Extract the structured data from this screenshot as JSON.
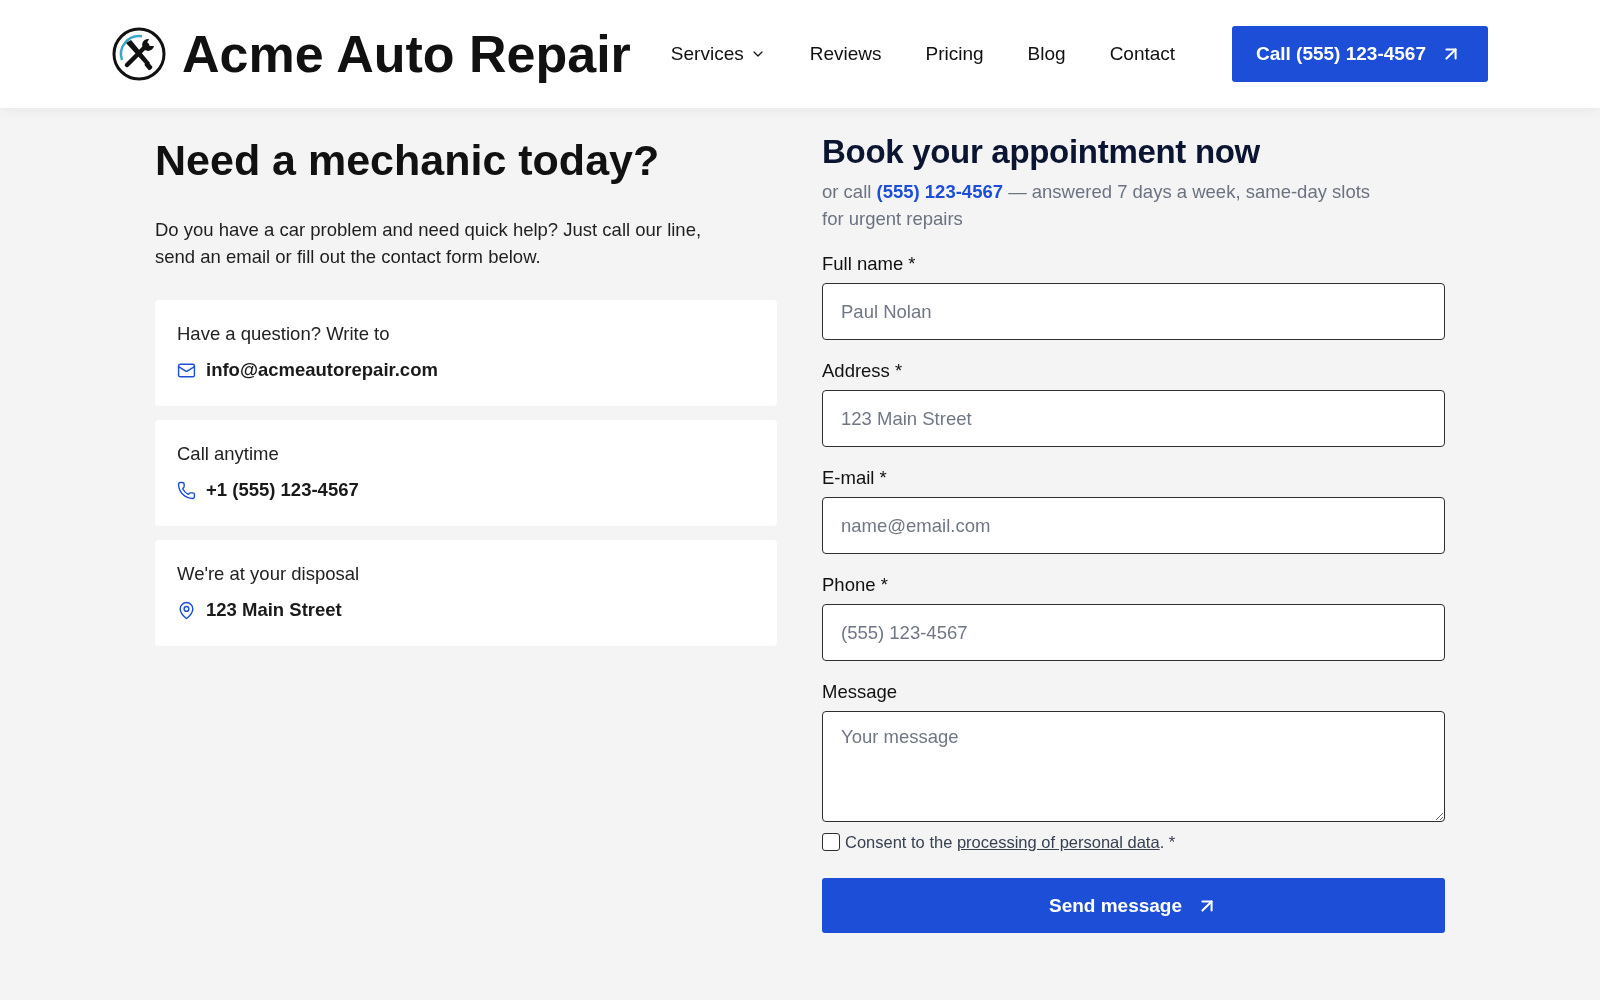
{
  "header": {
    "logo": {
      "text": "Acme Auto Repair"
    },
    "nav": [
      {
        "label": "Services",
        "dropdown": true
      },
      {
        "label": "Reviews",
        "dropdown": false
      },
      {
        "label": "Pricing",
        "dropdown": false
      },
      {
        "label": "Blog",
        "dropdown": false
      },
      {
        "label": "Contact",
        "dropdown": false
      }
    ],
    "call_button": {
      "label": "Call (555) 123-4567"
    }
  },
  "intro": {
    "title": "Need a mechanic today?",
    "text": "Do you have a car problem and need quick help? Just call our line, send an email or fill out the contact form below."
  },
  "contact_cards": [
    {
      "kind": "email",
      "label": "Have a question? Write to",
      "value": "info@acmeautorepair.com"
    },
    {
      "kind": "phone",
      "label": "Call anytime",
      "value": "+1 (555) 123-4567"
    },
    {
      "kind": "address",
      "label": "We're at your disposal",
      "value": "123 Main Street"
    }
  ],
  "form": {
    "title": "Book your appointment now",
    "subtitle": {
      "prefix": "or call",
      "phone": "(555) 123-4567",
      "suffix": "— answered 7 days a week, same-day slots for urgent repairs"
    },
    "fields": [
      {
        "kind": "input",
        "label": "Full name *",
        "placeholder": "Paul Nolan"
      },
      {
        "kind": "input",
        "label": "Address *",
        "placeholder": "123 Main Street"
      },
      {
        "kind": "input",
        "label": "E-mail *",
        "placeholder": "name@email.com"
      },
      {
        "kind": "input",
        "label": "Phone *",
        "placeholder": "(555) 123-4567"
      },
      {
        "kind": "textarea",
        "label": "Message",
        "placeholder": "Your message"
      }
    ],
    "consent": {
      "checked": false,
      "prefix": "Consent to the",
      "link": "processing of personal data",
      "suffix": ". *"
    },
    "submit": {
      "label": "Send message"
    }
  }
}
